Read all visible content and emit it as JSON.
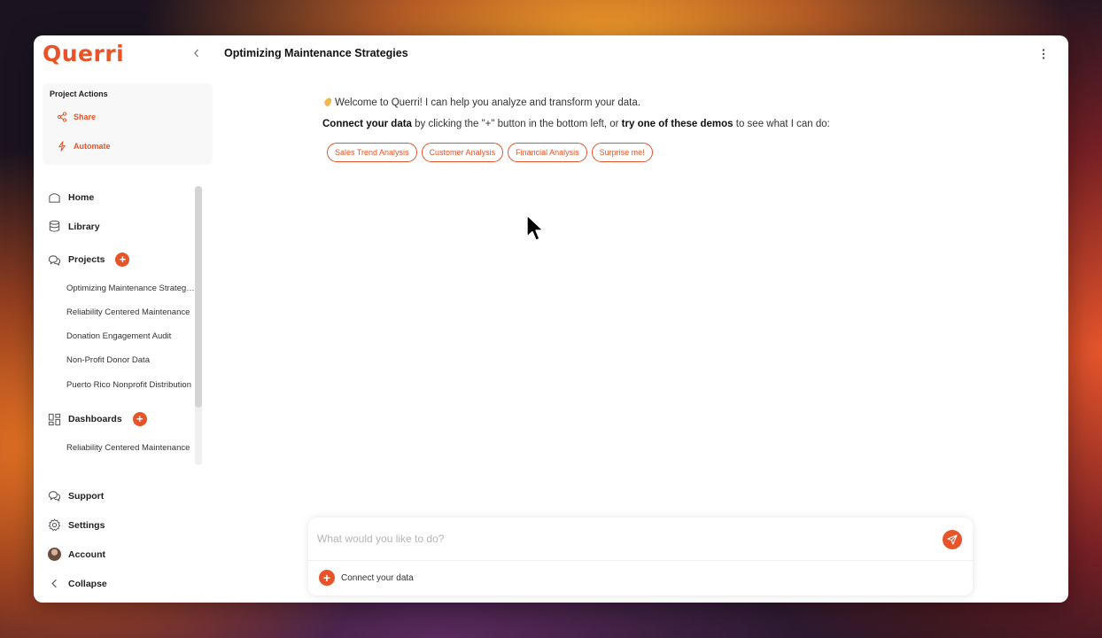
{
  "app": {
    "logo": "Querri",
    "title": "Optimizing Maintenance Strategies"
  },
  "project_actions": {
    "title": "Project Actions",
    "items": [
      {
        "label": "Share",
        "icon": "share-icon"
      },
      {
        "label": "Automate",
        "icon": "lightning-icon"
      }
    ]
  },
  "nav": {
    "home": "Home",
    "library": "Library",
    "projects": {
      "label": "Projects",
      "items": [
        "Optimizing Maintenance Strategies",
        "Reliability Centered Maintenance",
        "Donation Engagement Audit",
        "Non-Profit Donor Data",
        "Puerto Rico Nonprofit Distribution"
      ]
    },
    "dashboards": {
      "label": "Dashboards",
      "items": [
        "Reliability Centered Maintenance"
      ]
    }
  },
  "bottom_nav": {
    "support": "Support",
    "settings": "Settings",
    "account": "Account",
    "collapse": "Collapse"
  },
  "main": {
    "welcome": "Welcome to Querri! I can help you analyze and transform your data.",
    "connect_bold": "Connect your data",
    "connect_mid": " by clicking the \"+\" button in the bottom left, or ",
    "demos_bold": "try one of these demos",
    "connect_end": " to see what I can do:",
    "chips": [
      "Sales Trend Analysis",
      "Customer Analysis",
      "Financial Analysis",
      "Surprise me!"
    ]
  },
  "composer": {
    "placeholder": "What would you like to do?",
    "connect_label": "Connect your data"
  },
  "colors": {
    "accent": "#e8542a"
  }
}
